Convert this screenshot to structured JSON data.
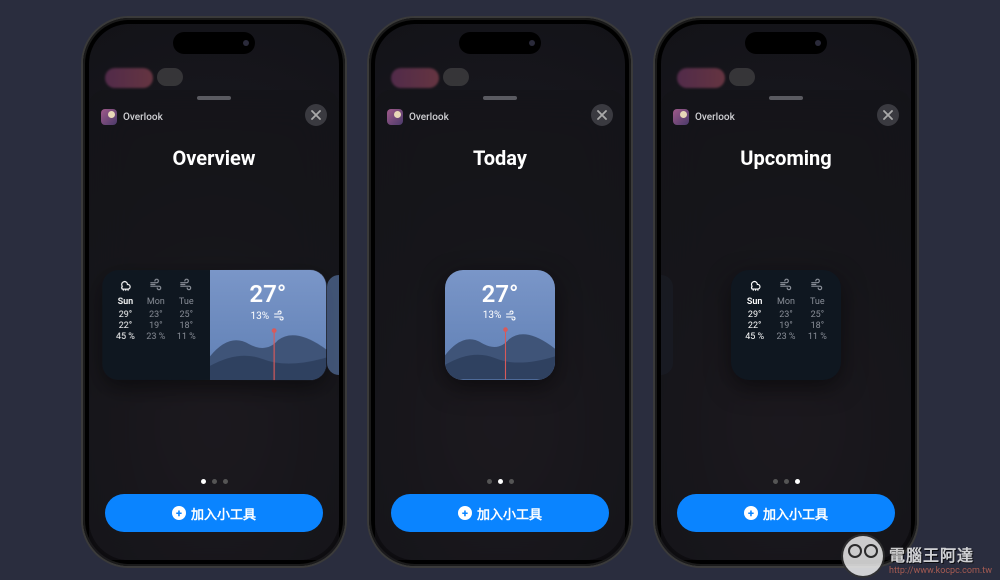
{
  "app_name": "Overlook",
  "add_button_label": "加入小工具",
  "screens": [
    {
      "title": "Overview",
      "dot_active": 0,
      "widget": "medium"
    },
    {
      "title": "Today",
      "dot_active": 1,
      "widget": "small_blue"
    },
    {
      "title": "Upcoming",
      "dot_active": 2,
      "widget": "small_dark"
    }
  ],
  "today": {
    "temp": "27°",
    "precip": "13%"
  },
  "forecast": {
    "days": [
      "Sun",
      "Mon",
      "Tue"
    ],
    "icons": [
      "rain",
      "wind",
      "wind"
    ],
    "high": [
      "29°",
      "23°",
      "25°"
    ],
    "low": [
      "22°",
      "19°",
      "18°"
    ],
    "precip": [
      "45 %",
      "23 %",
      "11 %"
    ]
  },
  "watermark": {
    "title": "電腦王阿達",
    "url": "http://www.kocpc.com.tw"
  }
}
